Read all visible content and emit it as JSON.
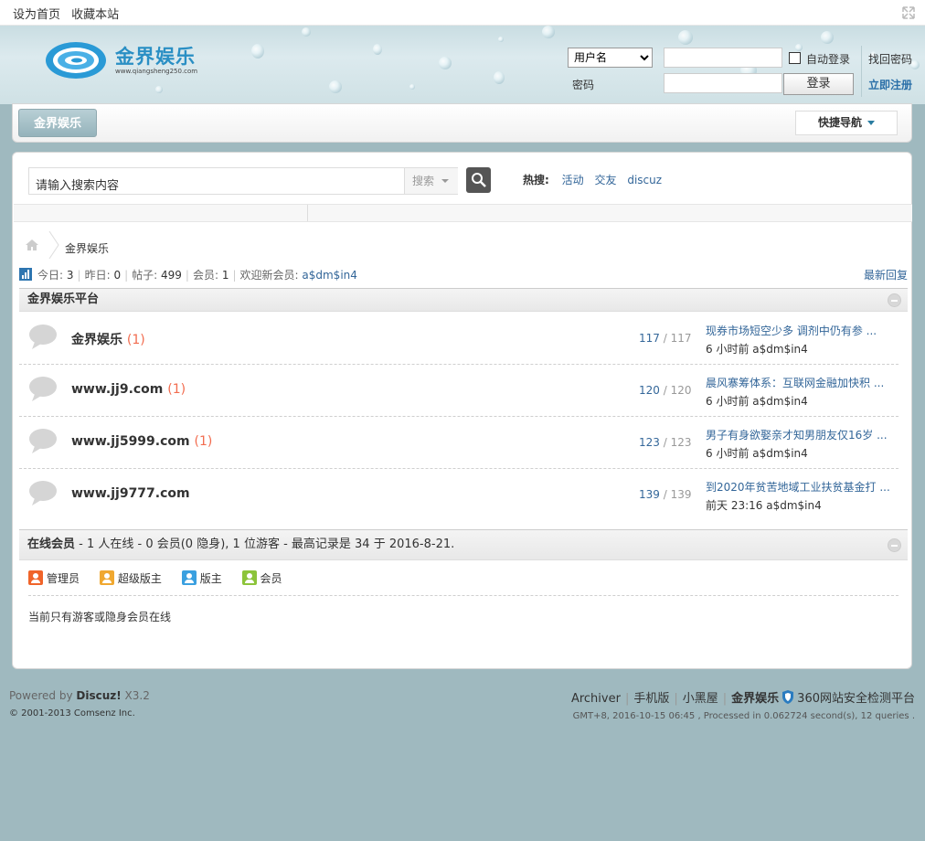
{
  "topbar": {
    "set_home": "设为首页",
    "bookmark": "收藏本站"
  },
  "header": {
    "brand": "金界娱乐",
    "url": "www.qiangsheng250.com"
  },
  "login": {
    "username_option": "用户名",
    "password_label": "密码",
    "auto_login": "自动登录",
    "forgot": "找回密码",
    "login_btn": "登录",
    "register": "立即注册"
  },
  "nav": {
    "tab": "金界娱乐",
    "quick": "快捷导航"
  },
  "search": {
    "placeholder": "请输入搜索内容",
    "type": "搜索",
    "hot_label": "热搜:",
    "hot": [
      "活动",
      "交友",
      "discuz"
    ]
  },
  "breadcrumb": {
    "label": "金界娱乐"
  },
  "stats": {
    "today_label": "今日:",
    "today": "3",
    "yesterday_label": "昨日:",
    "yesterday": "0",
    "posts_label": "帖子:",
    "posts": "499",
    "members_label": "会员:",
    "members": "1",
    "welcome_label": "欢迎新会员:",
    "newest_member": "a$dm$in4",
    "latest_reply": "最新回复"
  },
  "category": {
    "title": "金界娱乐平台"
  },
  "forums": [
    {
      "name": "金界娱乐",
      "new": "(1)",
      "threads": "117",
      "posts": "117",
      "last_title": "现券市场短空少多 调剂中仍有参 ...",
      "last_time": "6 小时前",
      "last_user": "a$dm$in4"
    },
    {
      "name": "www.jj9.com",
      "new": "(1)",
      "threads": "120",
      "posts": "120",
      "last_title": "晨风寨筹体系：互联网金融加快积 ...",
      "last_time": "6 小时前",
      "last_user": "a$dm$in4"
    },
    {
      "name": "www.jj5999.com",
      "new": "(1)",
      "threads": "123",
      "posts": "123",
      "last_title": "男子有身欲娶亲才知男朋友仅16岁 ...",
      "last_time": "6 小时前",
      "last_user": "a$dm$in4"
    },
    {
      "name": "www.jj9777.com",
      "new": "",
      "threads": "139",
      "posts": "139",
      "last_title": "到2020年贫苦地域工业扶贫基金打 ...",
      "last_time": "前天 23:16",
      "last_user": "a$dm$in4"
    }
  ],
  "online": {
    "title": "在线会员",
    "summary": " - 1 人在线  - 0 会员(0 隐身), 1 位游客  - 最高记录是  34  于  2016-8-21.",
    "legend": [
      "管理员",
      "超级版主",
      "版主",
      "会员"
    ],
    "legend_colors": [
      "#f0642a",
      "#f0a830",
      "#3aa0e0",
      "#8cc43a"
    ],
    "only_guests": "当前只有游客或隐身会员在线"
  },
  "footer": {
    "powered": "Powered by ",
    "discuz": "Discuz!",
    "version": " X3.2",
    "copyright": "© 2001-2013 Comsenz Inc.",
    "links": [
      "Archiver",
      "手机版",
      "小黑屋",
      "金界娱乐",
      "360网站安全检测平台"
    ],
    "gmt": "GMT+8, 2016-10-15 06:45 , Processed in 0.062724 second(s), 12 queries ."
  }
}
